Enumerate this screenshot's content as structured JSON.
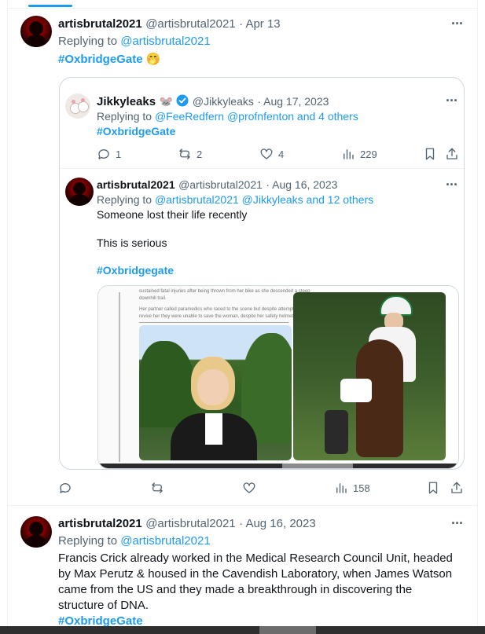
{
  "tweet1": {
    "display_name": "artisbrutal2021",
    "handle": "@artisbrutal2021",
    "date": "· Apr 13",
    "replying_prefix": "Replying to",
    "replying_to": "@artisbrutal2021",
    "hashtag": "#OxbridgeGate",
    "emoji": "🤭"
  },
  "quoted": {
    "display_name": "Jikkyleaks",
    "name_emoji": "🐭",
    "handle": "@Jikkyleaks",
    "date": "· Aug 17, 2023",
    "replying_prefix": "Replying to",
    "replying_to": "@FeeRedfern @profnfenton and 4 others",
    "hashtag": "#OxbridgeGate",
    "actions": {
      "replies": "1",
      "reposts": "2",
      "likes": "4",
      "views": "229"
    }
  },
  "quoted_reply": {
    "display_name": "artisbrutal2021",
    "handle": "@artisbrutal2021",
    "date": "· Aug 16, 2023",
    "replying_prefix": "Replying to",
    "replying_to": "@artisbrutal2021 @Jikkyleaks and 12 others",
    "text_line1": "Someone lost their life recently",
    "text_line2": "This is serious",
    "hashtag": "#Oxbridgegate",
    "image_text_line1": "sustained fatal injuries after being thrown from her bike as she descended a steep",
    "image_text_line2": "downhill trail.",
    "image_text_line3": "Her partner called paramedics who raced to the scene but despite attempts to",
    "image_text_line4": "revive her they were unable to save the woman, despite her safety helmet."
  },
  "tweet1_actions": {
    "views": "158"
  },
  "tweet2": {
    "display_name": "artisbrutal2021",
    "handle": "@artisbrutal2021",
    "date": "· Aug 16, 2023",
    "replying_prefix": "Replying to",
    "replying_to": "@artisbrutal2021",
    "body_line1": "Francis Crick already worked in the Medical Research Council Unit, headed",
    "body_line2": "by Max Perutz & housed in the Cavendish Laboratory, when James Watson",
    "body_line3": "came from the US and they made a breakthrough in discovering the",
    "body_line4": "structure of DNA.",
    "hashtag": "#OxbridgeGate"
  },
  "colors": {
    "accent": "#1d9bf0",
    "muted": "#536471",
    "text": "#0f1419",
    "border": "#cfd9de"
  },
  "icons": [
    "more-icon",
    "verified-icon",
    "reply-icon",
    "repost-icon",
    "like-icon",
    "views-icon",
    "bookmark-icon",
    "share-icon"
  ]
}
